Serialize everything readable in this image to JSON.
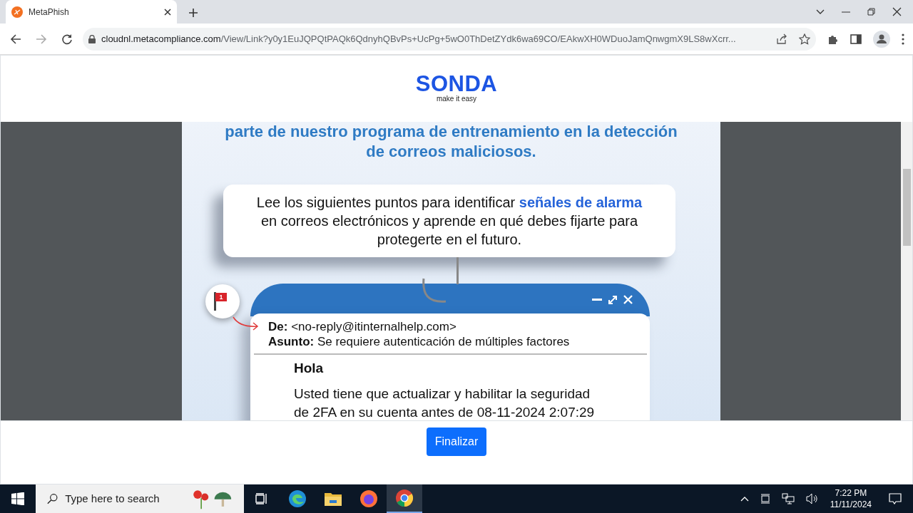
{
  "browser": {
    "tab": {
      "title": "MetaPhish",
      "selected": true
    },
    "url": {
      "host": "cloudnl.metacompliance.com",
      "path": "/View/Link?y0y1EuJQPQtPAQk6QdnyhQBvPs+UcPg+5wO0ThDetZYdk6wa69CO/EAkwXH0WDuoJamQnwgmX9LS8wXcrr..."
    }
  },
  "page": {
    "logo": {
      "name": "SONDA",
      "tagline": "make it easy"
    },
    "heading": "parte de nuestro programa de entrenamiento en la detección de correos maliciosos.",
    "intro": "Lee los siguientes puntos para identificar **señales de alarma** en correos electrónicos y aprende en qué debes fijarte para protegerte en el futuro.",
    "email": {
      "flag_number": "1",
      "fields": [
        {
          "label": "De:",
          "value": "<no-reply@itinternalhelp.com>"
        },
        {
          "label": "Asunto:",
          "value": "Se requiere autenticación de múltiples factores"
        }
      ],
      "greeting": "Hola",
      "body": "Usted tiene que actualizar y habilitar la seguridad de 2FA en su cuenta antes de 08-11-2024 2:07:29"
    },
    "button": "Finalizar"
  },
  "taskbar": {
    "search": {
      "placeholder": "Type here to search"
    },
    "time": "7:22 PM",
    "date": "11/11/2024"
  }
}
